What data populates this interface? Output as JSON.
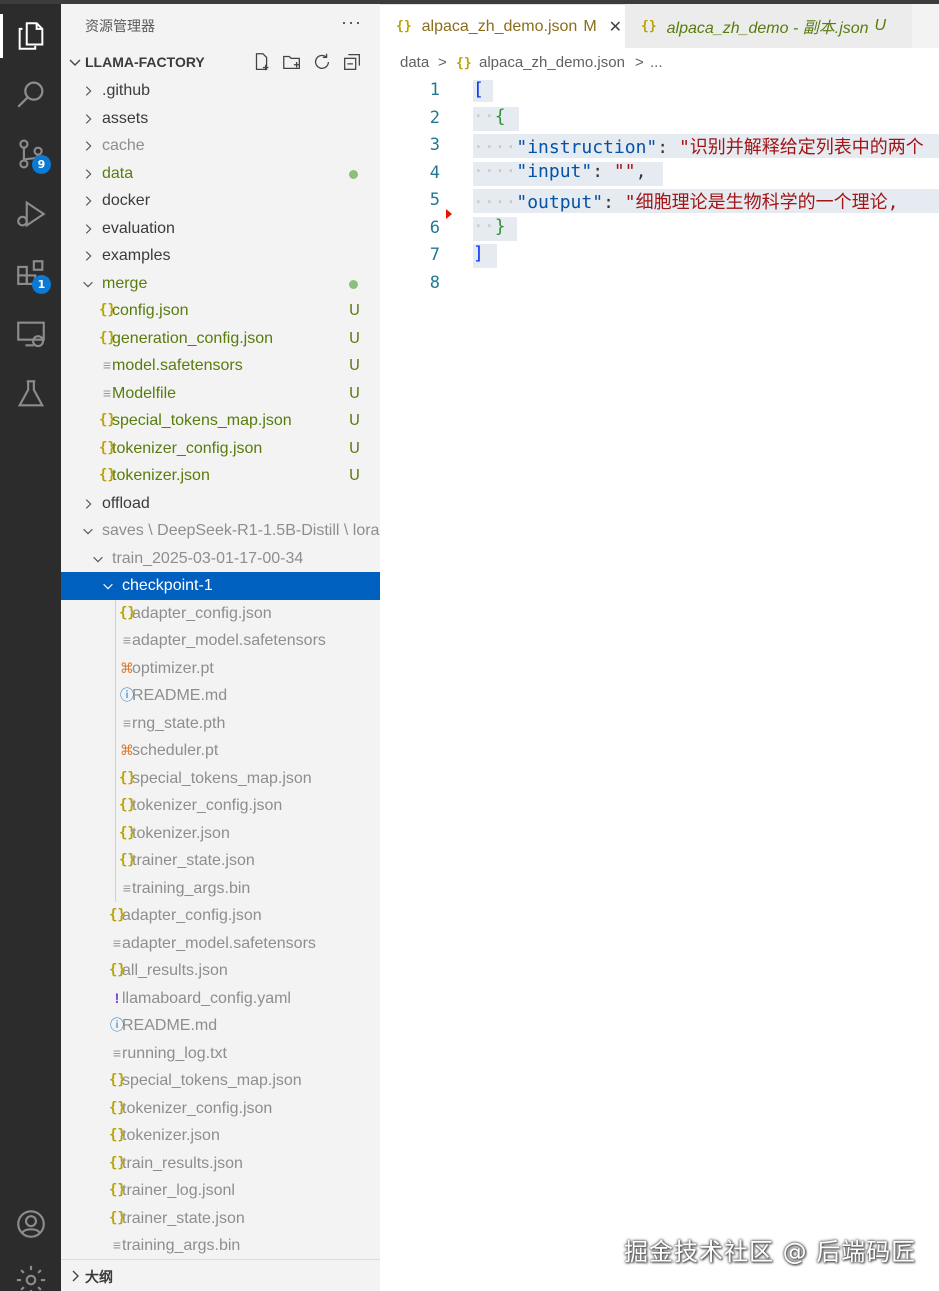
{
  "activity_bar": {
    "items": [
      {
        "name": "explorer",
        "badge": ""
      },
      {
        "name": "search",
        "badge": ""
      },
      {
        "name": "source-control",
        "badge": "9"
      },
      {
        "name": "run-debug",
        "badge": ""
      },
      {
        "name": "extensions",
        "badge": "1"
      },
      {
        "name": "remote-explorer",
        "badge": ""
      },
      {
        "name": "testing",
        "badge": ""
      },
      {
        "name": "accounts",
        "badge": ""
      },
      {
        "name": "manage",
        "badge": ""
      }
    ]
  },
  "sidebar": {
    "title": "资源管理器",
    "more": "···",
    "section": "LLAMA-FACTORY",
    "outline": "大纲",
    "tree": [
      {
        "label": ".github",
        "kind": "folder",
        "color": "normal",
        "status": ""
      },
      {
        "label": "assets",
        "kind": "folder",
        "color": "normal",
        "status": ""
      },
      {
        "label": "cache",
        "kind": "folder",
        "color": "ignored",
        "status": ""
      },
      {
        "label": "data",
        "kind": "folder",
        "color": "untracked",
        "status": "dot"
      },
      {
        "label": "docker",
        "kind": "folder",
        "color": "normal",
        "status": ""
      },
      {
        "label": "evaluation",
        "kind": "folder",
        "color": "normal",
        "status": ""
      },
      {
        "label": "examples",
        "kind": "folder",
        "color": "normal",
        "status": ""
      },
      {
        "label": "merge",
        "kind": "folder-open",
        "color": "untracked",
        "status": "dot"
      },
      {
        "label": "config.json",
        "kind": "json",
        "color": "untracked",
        "status": "U"
      },
      {
        "label": "generation_config.json",
        "kind": "json",
        "color": "untracked",
        "status": "U"
      },
      {
        "label": "model.safetensors",
        "kind": "lines",
        "color": "untracked",
        "status": "U"
      },
      {
        "label": "Modelfile",
        "kind": "lines",
        "color": "untracked",
        "status": "U"
      },
      {
        "label": "special_tokens_map.json",
        "kind": "json",
        "color": "untracked",
        "status": "U"
      },
      {
        "label": "tokenizer_config.json",
        "kind": "json",
        "color": "untracked",
        "status": "U"
      },
      {
        "label": "tokenizer.json",
        "kind": "json",
        "color": "untracked",
        "status": "U"
      },
      {
        "label": "offload",
        "kind": "folder",
        "color": "normal",
        "status": ""
      },
      {
        "label": "saves \\ DeepSeek-R1-1.5B-Distill \\ lora",
        "kind": "folder-open",
        "color": "ignored",
        "status": ""
      },
      {
        "label": "train_2025-03-01-17-00-34",
        "kind": "folder-open",
        "color": "ignored",
        "status": ""
      },
      {
        "label": "checkpoint-1",
        "kind": "folder-open",
        "color": "selected",
        "status": ""
      },
      {
        "label": "adapter_config.json",
        "kind": "json",
        "color": "ignored",
        "status": ""
      },
      {
        "label": "adapter_model.safetensors",
        "kind": "lines",
        "color": "ignored",
        "status": ""
      },
      {
        "label": "optimizer.pt",
        "kind": "rss",
        "color": "ignored",
        "status": ""
      },
      {
        "label": "README.md",
        "kind": "info",
        "color": "ignored",
        "status": ""
      },
      {
        "label": "rng_state.pth",
        "kind": "lines",
        "color": "ignored",
        "status": ""
      },
      {
        "label": "scheduler.pt",
        "kind": "rss",
        "color": "ignored",
        "status": ""
      },
      {
        "label": "special_tokens_map.json",
        "kind": "json",
        "color": "ignored",
        "status": ""
      },
      {
        "label": "tokenizer_config.json",
        "kind": "json",
        "color": "ignored",
        "status": ""
      },
      {
        "label": "tokenizer.json",
        "kind": "json",
        "color": "ignored",
        "status": ""
      },
      {
        "label": "trainer_state.json",
        "kind": "json",
        "color": "ignored",
        "status": ""
      },
      {
        "label": "training_args.bin",
        "kind": "lines",
        "color": "ignored",
        "status": ""
      },
      {
        "label": "adapter_config.json",
        "kind": "json",
        "color": "ignored",
        "status": ""
      },
      {
        "label": "adapter_model.safetensors",
        "kind": "lines",
        "color": "ignored",
        "status": ""
      },
      {
        "label": "all_results.json",
        "kind": "json",
        "color": "ignored",
        "status": ""
      },
      {
        "label": "llamaboard_config.yaml",
        "kind": "yaml",
        "color": "ignored",
        "status": ""
      },
      {
        "label": "README.md",
        "kind": "info",
        "color": "ignored",
        "status": ""
      },
      {
        "label": "running_log.txt",
        "kind": "lines",
        "color": "ignored",
        "status": ""
      },
      {
        "label": "special_tokens_map.json",
        "kind": "json",
        "color": "ignored",
        "status": ""
      },
      {
        "label": "tokenizer_config.json",
        "kind": "json",
        "color": "ignored",
        "status": ""
      },
      {
        "label": "tokenizer.json",
        "kind": "json",
        "color": "ignored",
        "status": ""
      },
      {
        "label": "train_results.json",
        "kind": "json",
        "color": "ignored",
        "status": ""
      },
      {
        "label": "trainer_log.jsonl",
        "kind": "json",
        "color": "ignored",
        "status": ""
      },
      {
        "label": "trainer_state.json",
        "kind": "json",
        "color": "ignored",
        "status": ""
      },
      {
        "label": "training_args.bin",
        "kind": "lines",
        "color": "ignored",
        "status": ""
      }
    ]
  },
  "tabs": [
    {
      "icon": "{}",
      "name": "alpaca_zh_demo.json",
      "status": "M",
      "close": "✕"
    },
    {
      "icon": "{}",
      "name": "alpaca_zh_demo - 副本.json",
      "status": "U"
    }
  ],
  "breadcrumb": {
    "folder": "data",
    "sep": ">",
    "icon": "{}",
    "file": "alpaca_zh_demo.json",
    "tail": "..."
  },
  "editor": {
    "line_numbers": [
      "1",
      "2",
      "3",
      "4",
      "5",
      "6",
      "7",
      "8"
    ],
    "lines": {
      "l1": "[",
      "l2": "{",
      "l3_key": "\"instruction\"",
      "l3_sep": ": ",
      "l3_val": "\"识别并解释给定列表中的两个",
      "l4_key": "\"input\"",
      "l4_sep": ": ",
      "l4_val": "\"\"",
      "l4_end": ",",
      "l5_key": "\"output\"",
      "l5_sep": ": ",
      "l5_val": "\"细胞理论是生物科学的一个理论,",
      "l6": "}",
      "l7": "]"
    }
  },
  "watermark": "掘金技术社区 @ 后端码匠",
  "colors": {
    "selection": "#0060c0",
    "badge": "#0a7ad4",
    "untracked": "#587c0c",
    "ignored": "#8e8e8e"
  }
}
